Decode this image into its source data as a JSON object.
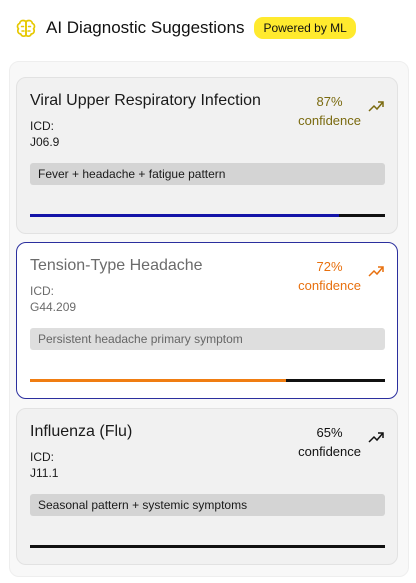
{
  "header": {
    "title": "AI Diagnostic Suggestions",
    "badge": "Powered by ML"
  },
  "suggestions": [
    {
      "name": "Viral Upper Respiratory Infection",
      "icd_label": "ICD:",
      "icd_code": "J06.9",
      "confidence_value": "87%",
      "confidence_label": "confidence",
      "confidence": 0.87,
      "color": "#7a6a0f",
      "bar_color": "#1414a8",
      "reason": "Fever + headache + fatigue pattern"
    },
    {
      "name": "Tension-Type Headache",
      "icd_label": "ICD:",
      "icd_code": "G44.209",
      "confidence_value": "72%",
      "confidence_label": "confidence",
      "confidence": 0.72,
      "color": "#e8700e",
      "bar_color": "#f07d12",
      "reason": "Persistent headache primary symptom"
    },
    {
      "name": "Influenza (Flu)",
      "icd_label": "ICD:",
      "icd_code": "J11.1",
      "confidence_value": "65%",
      "confidence_label": "confidence",
      "confidence": 0.65,
      "color": "#111111",
      "bar_color": "#111111",
      "reason": "Seasonal pattern + systemic symptoms"
    }
  ]
}
